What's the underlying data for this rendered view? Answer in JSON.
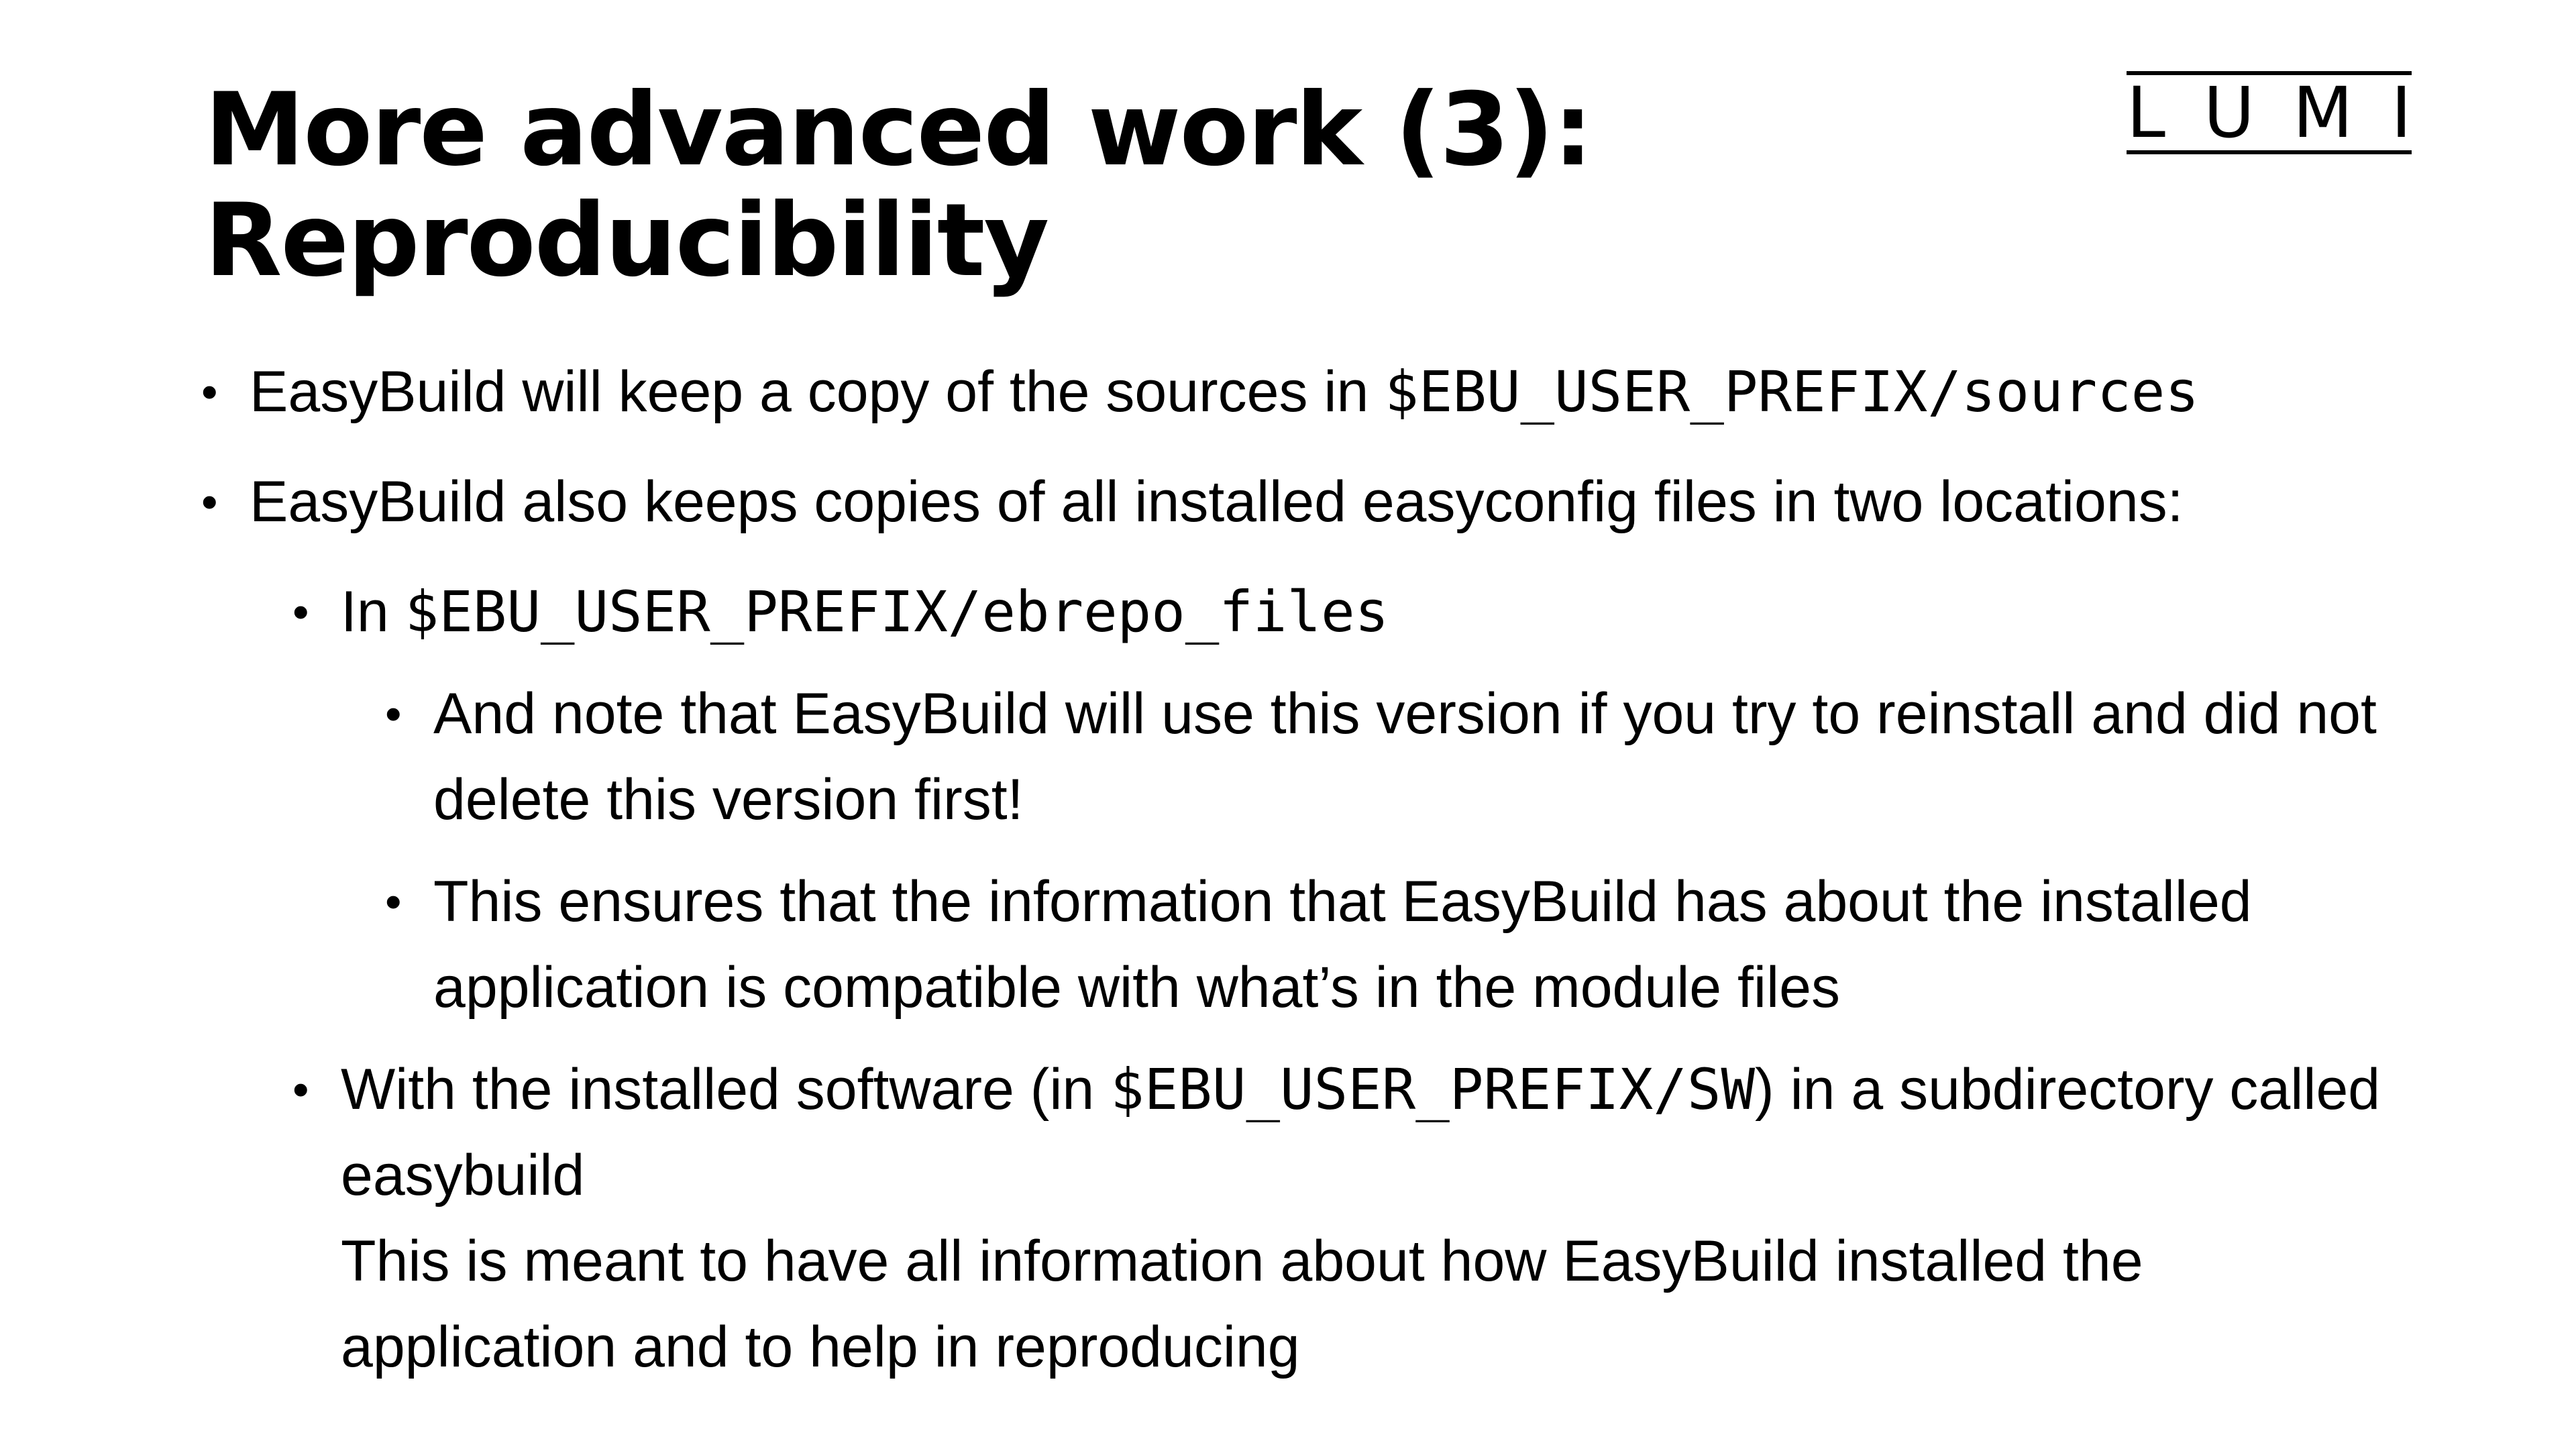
{
  "slide": {
    "title_line1": "More advanced work (3):",
    "title_line2": "Reproducibility"
  },
  "logo": {
    "letters": [
      "L",
      "U",
      "M",
      "I"
    ]
  },
  "bullets": {
    "b1": {
      "text": "EasyBuild will keep a copy of the sources in ",
      "code": "$EBU_USER_PREFIX/sources"
    },
    "b2": {
      "text": "EasyBuild also keeps copies of all installed easyconfig files in two locations:"
    },
    "b2_1": {
      "text": "In ",
      "code": "$EBU_USER_PREFIX/ebrepo_files"
    },
    "b2_1_1": {
      "text": "And note that EasyBuild will use this version if you try to reinstall and did not delete this version first!"
    },
    "b2_1_2": {
      "text": "This ensures that the information that EasyBuild has about the installed application is compatible with what’s in the module files"
    },
    "b2_2": {
      "text_before": "With the installed software (in ",
      "code": "$EBU_USER_PREFIX/SW",
      "text_after": ") in a subdirectory called easybuild",
      "continuation": "This is meant to have all information about how EasyBuild installed the application and to help in reproducing"
    }
  }
}
